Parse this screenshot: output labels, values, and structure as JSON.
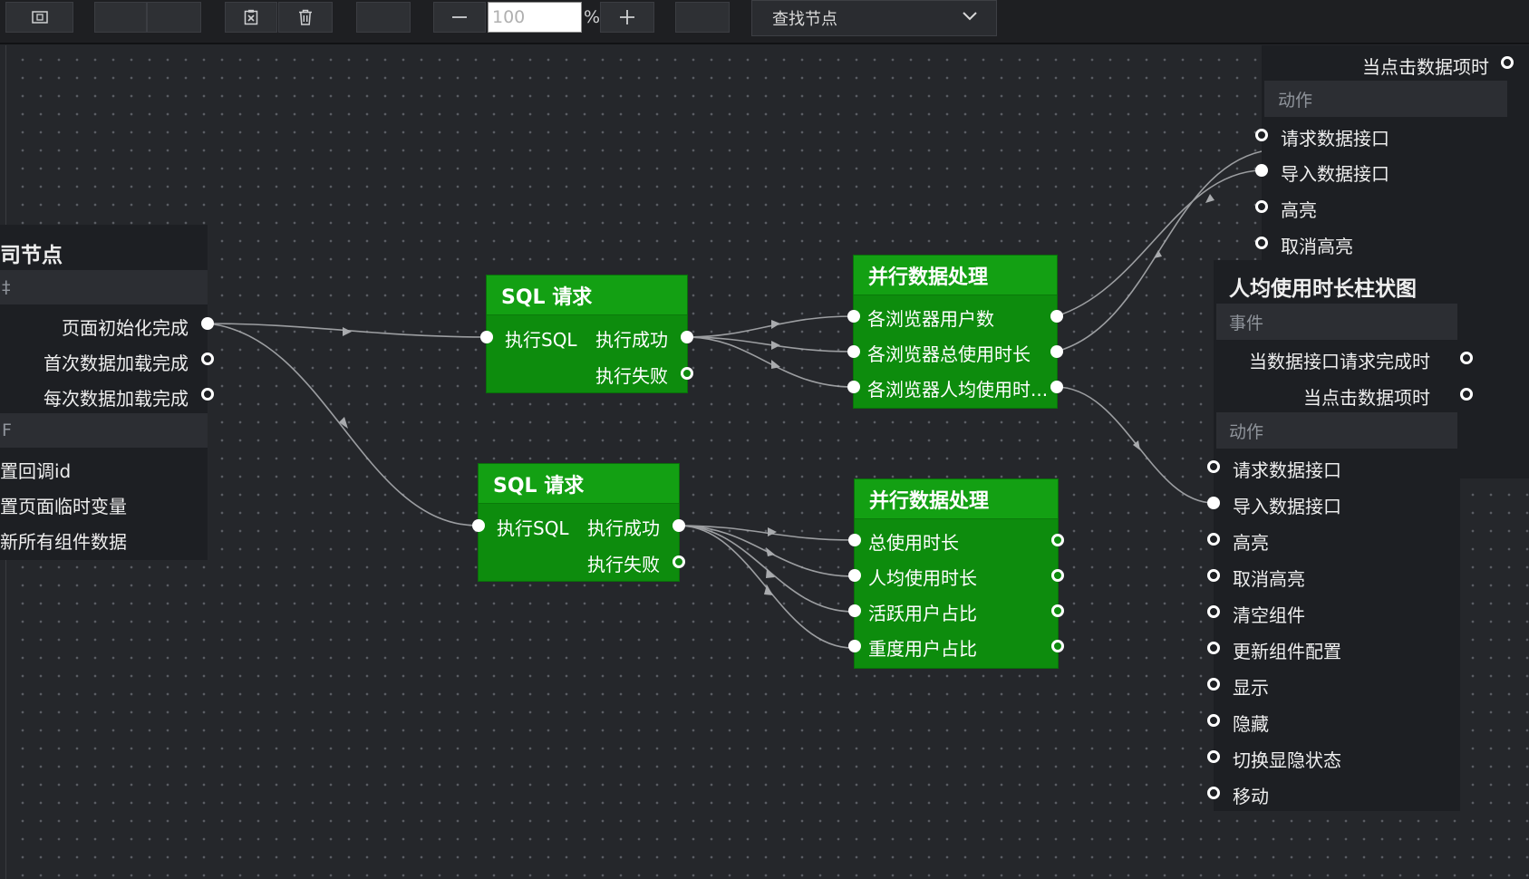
{
  "toolbar": {
    "zoom_value": "100",
    "zoom_unit": "%",
    "find_node_label": "查找节点"
  },
  "left_panel": {
    "title": "司节点",
    "section1_header": "‡",
    "events": [
      "页面初始化完成",
      "首次数据加载完成",
      "每次数据加载完成"
    ],
    "section2_header": "F",
    "actions": [
      "置回调id",
      "置页面临时变量",
      "新所有组件数据"
    ]
  },
  "sql_node_1": {
    "title": "SQL 请求",
    "input": "执行SQL",
    "out_success": "执行成功",
    "out_fail": "执行失败"
  },
  "sql_node_2": {
    "title": "SQL 请求",
    "input": "执行SQL",
    "out_success": "执行成功",
    "out_fail": "执行失败"
  },
  "parallel_node_1": {
    "title": "并行数据处理",
    "rows": [
      "各浏览器用户数",
      "各浏览器总使用时长",
      "各浏览器人均使用时..."
    ]
  },
  "parallel_node_2": {
    "title": "并行数据处理",
    "rows": [
      "总使用时长",
      "人均使用时长",
      "活跃用户占比",
      "重度用户占比"
    ]
  },
  "right_panel_back": {
    "event_top": "当点击数据项时",
    "actions_header": "动作",
    "actions": [
      "请求数据接口",
      "导入数据接口",
      "高亮",
      "取消高亮"
    ]
  },
  "right_panel_front": {
    "title": "人均使用时长柱状图",
    "events_header": "事件",
    "events": [
      "当数据接口请求完成时",
      "当点击数据项时"
    ],
    "actions_header": "动作",
    "actions": [
      "请求数据接口",
      "导入数据接口",
      "高亮",
      "取消高亮",
      "清空组件",
      "更新组件配置",
      "显示",
      "隐藏",
      "切换显隐状态",
      "移动"
    ]
  },
  "colors": {
    "canvas_bg": "#25272b",
    "node_green": "#0d8c0d",
    "node_title_green": "#13a013",
    "panel_bg": "#1d1f23"
  }
}
